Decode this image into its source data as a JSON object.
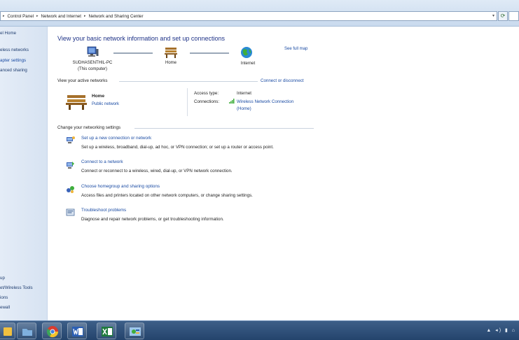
{
  "address": {
    "crumbs": [
      "Control Panel",
      "Network and Internet",
      "Network and Sharing Center"
    ],
    "separator": "▸"
  },
  "sidebar": {
    "top_items": [
      "el Home",
      "eless networks",
      "apter settings",
      "anced sharing"
    ],
    "bottom_items": [
      "up",
      "et/Wireless Tools",
      "ions",
      "ewall"
    ]
  },
  "main": {
    "title": "View your basic network information and set up connections",
    "see_full_map": "See full map",
    "map": {
      "computer_name": "SUDHASENTHIL-PC",
      "computer_sub": "(This computer)",
      "middle": "Home",
      "end": "Internet"
    },
    "active": {
      "heading": "View your active networks",
      "connect_link": "Connect or disconnect",
      "network_name": "Home",
      "network_type": "Public network",
      "access_key": "Access type:",
      "access_val": "Internet",
      "conn_key": "Connections:",
      "conn_val": "Wireless Network Connection",
      "conn_sub": "(Home)"
    },
    "settings": {
      "heading": "Change your networking settings",
      "tasks": [
        {
          "title": "Set up a new connection or network",
          "desc": "Set up a wireless, broadband, dial-up, ad hoc, or VPN connection; or set up a router or access point."
        },
        {
          "title": "Connect to a network",
          "desc": "Connect or reconnect to a wireless, wired, dial-up, or VPN network connection."
        },
        {
          "title": "Choose homegroup and sharing options",
          "desc": "Access files and printers located on other network computers, or change sharing settings."
        },
        {
          "title": "Troubleshoot problems",
          "desc": "Diagnose and repair network problems, or get troubleshooting information."
        }
      ]
    }
  },
  "taskbar": {
    "apps": [
      "windows-explorer-icon",
      "folder-icon",
      "chrome-icon",
      "word-icon",
      "excel-icon",
      "control-panel-icon"
    ],
    "tray": "▲ ◂) ▮ ⌂"
  },
  "colors": {
    "link": "#1a4ba3",
    "title": "#1e3287",
    "taskbar": "#2c4e78"
  }
}
